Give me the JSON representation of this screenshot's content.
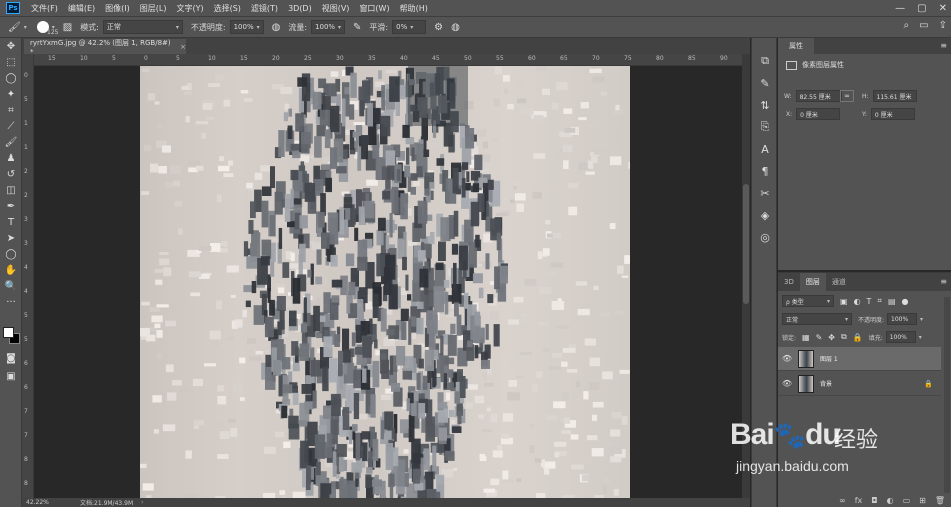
{
  "app": {
    "logo": "Ps"
  },
  "menu": [
    "文件(F)",
    "编辑(E)",
    "图像(I)",
    "图层(L)",
    "文字(Y)",
    "选择(S)",
    "滤镜(T)",
    "3D(D)",
    "视图(V)",
    "窗口(W)",
    "帮助(H)"
  ],
  "window_controls": [
    "—",
    "▢",
    "✕"
  ],
  "options": {
    "brush_size": "125",
    "mode_label": "模式:",
    "mode_value": "正常",
    "opacity_label": "不透明度:",
    "opacity_value": "100%",
    "flow_label": "流量:",
    "flow_value": "100%",
    "smooth_label": "平滑:",
    "smooth_value": "0%"
  },
  "document": {
    "tab_title": "ryrtYxmG.jpg @ 42.2% (图层 1, RGB/8#) *",
    "close": "×"
  },
  "ruler_top": [
    "15",
    "10",
    "5",
    "0",
    "5",
    "10",
    "15",
    "20",
    "25",
    "30",
    "35",
    "40",
    "45",
    "50",
    "55",
    "60",
    "65",
    "70",
    "75",
    "80",
    "85",
    "90",
    "95"
  ],
  "ruler_left": [
    "0",
    "5",
    "1",
    "1",
    "2",
    "2",
    "3",
    "3",
    "4",
    "4",
    "5",
    "5",
    "6",
    "6",
    "7",
    "7",
    "8",
    "8"
  ],
  "status": {
    "zoom": "42.22%",
    "doc_info": "文档:21.9M/43.9M",
    "arrow": "›"
  },
  "properties": {
    "tab": "属性",
    "header": "像素图层属性",
    "w_label": "W:",
    "w_value": "82.55 厘米",
    "h_label": "H:",
    "h_value": "115.61 厘米",
    "x_label": "X:",
    "x_value": "0 厘米",
    "y_label": "Y:",
    "y_value": "0 厘米",
    "link": "∞"
  },
  "layers_panel": {
    "tabs": [
      "3D",
      "图层",
      "通道"
    ],
    "active_tab": "图层",
    "filter_value": "ρ 类型",
    "blend_value": "正常",
    "opacity_label": "不透明度:",
    "opacity_value": "100%",
    "lock_label": "锁定:",
    "fill_label": "填充:",
    "fill_value": "100%",
    "layers": [
      {
        "name": "图层 1",
        "selected": true,
        "locked": false
      },
      {
        "name": "背景",
        "selected": false,
        "locked": true
      }
    ],
    "footer_icons": [
      "link-icon",
      "fx-icon",
      "mask-icon",
      "adjustment-icon",
      "group-icon",
      "new-layer-icon",
      "trash-icon"
    ]
  },
  "watermark": {
    "logo": "Bai",
    "logo2": "du",
    "cn": "经验",
    "url": "jingyan.baidu.com"
  }
}
